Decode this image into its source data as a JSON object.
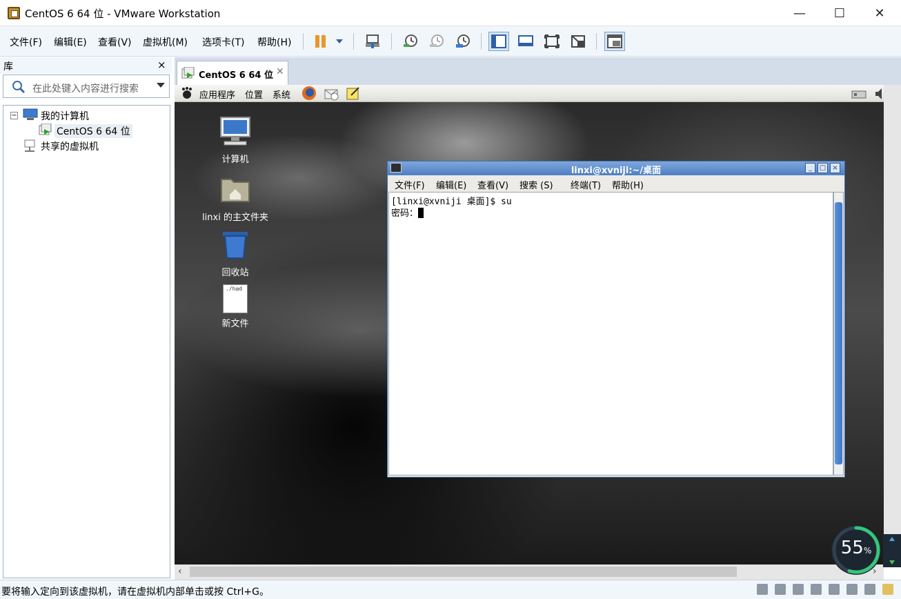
{
  "window": {
    "title": "CentOS 6 64 位 - VMware Workstation",
    "min_glyph": "—",
    "max_glyph": "☐",
    "close_glyph": "✕"
  },
  "menu": {
    "items": [
      "文件(F)",
      "编辑(E)",
      "查看(V)",
      "虚拟机(M)",
      "选项卡(T)",
      "帮助(H)"
    ]
  },
  "toolbar": {
    "icons": [
      "pause-icon",
      "dropdown-arrow-icon",
      "send-ctrl-alt-del-icon",
      "snapshot-take-icon",
      "snapshot-revert-icon",
      "snapshot-manager-icon",
      "view-console-icon",
      "view-full-icon",
      "view-fit-icon",
      "view-unity-icon",
      "view-thumbnail-icon"
    ]
  },
  "library": {
    "header": "库",
    "close": "×",
    "search_placeholder": "在此处键入内容进行搜索",
    "tree": {
      "my_computer": "我的计算机",
      "vm_name": "CentOS 6 64 位",
      "shared": "共享的虚拟机",
      "collapse_glyph": "−"
    }
  },
  "vm_tab": {
    "label": "CentOS 6 64 位",
    "close": "✕"
  },
  "guest_panel": {
    "items": [
      "应用程序",
      "位置",
      "系统"
    ]
  },
  "desktop_icons": [
    {
      "label": "计算机"
    },
    {
      "label": "linxi 的主文件夹"
    },
    {
      "label": "回收站"
    },
    {
      "label": "新文件",
      "preview": "./had"
    }
  ],
  "terminal": {
    "title": "linxi@xvniji:~/桌面",
    "menu": [
      "文件(F)",
      "编辑(E)",
      "查看(V)",
      "搜索 (S)",
      "终端(T)",
      "帮助(H)"
    ],
    "lines": [
      "[linxi@xvniji 桌面]$ su",
      "密码："
    ]
  },
  "status": {
    "message": "要将输入定向到该虚拟机，请在虚拟机内部单击或按 Ctrl+G。"
  },
  "gauge": {
    "value": 55,
    "unit": "%",
    "fraction": 0.55
  }
}
